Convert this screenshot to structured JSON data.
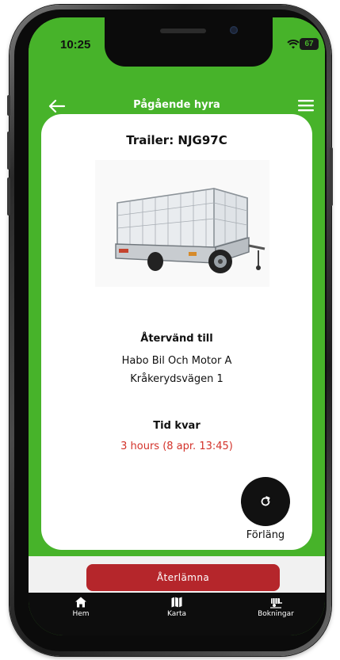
{
  "status_bar": {
    "time": "10:25",
    "battery": "67",
    "wifi_icon": "wifi-icon",
    "battery_icon": "battery-icon"
  },
  "header": {
    "title": "Pågående hyra",
    "back_icon": "arrow-left-icon",
    "menu_icon": "hamburger-menu-icon",
    "background_color": "#47b32a"
  },
  "rental": {
    "trailer_title": "Trailer: NJG97C",
    "image_alt": "trailer-image",
    "return_label": "Återvänd till",
    "return_location": "Habo Bil Och Motor A",
    "return_address": "Kråkerydsvägen 1",
    "time_label": "Tid kvar",
    "time_remaining": "3 hours (8 apr. 13:45)",
    "time_color": "#d3322a"
  },
  "extend": {
    "label": "Förläng",
    "icon": "refresh-icon"
  },
  "return_button": {
    "label": "Återlämna",
    "color": "#b5262b"
  },
  "nav": {
    "items": [
      {
        "label": "Hem",
        "icon": "home-icon"
      },
      {
        "label": "Karta",
        "icon": "map-icon"
      },
      {
        "label": "Bokningar",
        "icon": "trailer-icon"
      }
    ]
  }
}
